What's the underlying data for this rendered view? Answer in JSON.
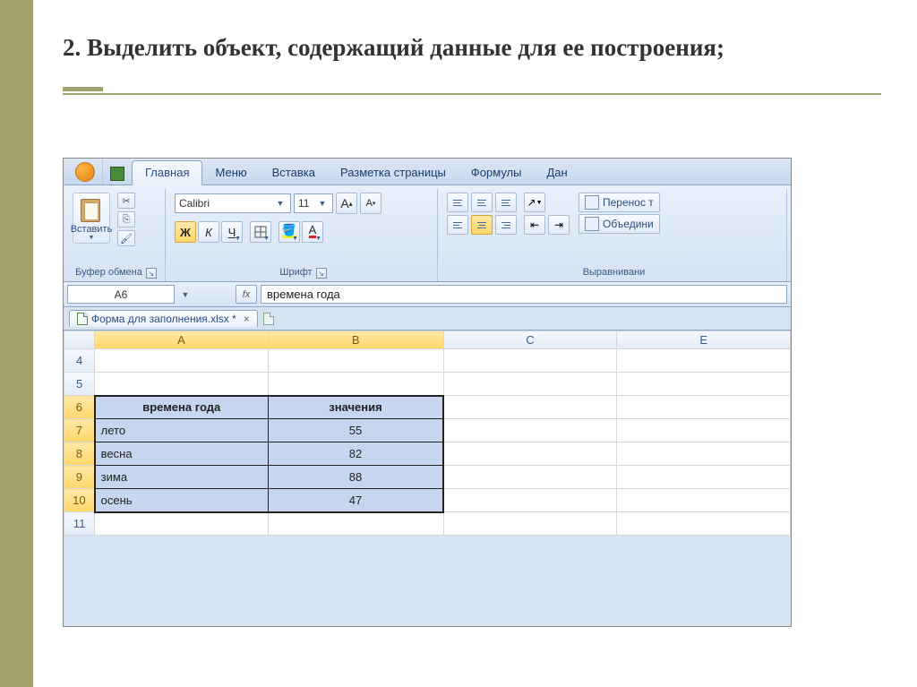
{
  "slide": {
    "title": "2. Выделить объект, содержащий данные для ее построения;"
  },
  "tabs": {
    "home": "Главная",
    "menu": "Меню",
    "insert": "Вставка",
    "layout": "Разметка страницы",
    "formulas": "Формулы",
    "data": "Дан"
  },
  "ribbon": {
    "clipboard_label": "Буфер обмена",
    "paste": "Вставить",
    "font_label": "Шрифт",
    "font_name": "Calibri",
    "font_size": "11",
    "align_label": "Выравнивани",
    "wrap": "Перенос т",
    "merge": "Объедини"
  },
  "formula": {
    "cell_ref": "А6",
    "value": "времена года"
  },
  "workbook": {
    "tab": "Форма для заполнения.xlsx *"
  },
  "grid": {
    "cols": [
      "A",
      "B",
      "C",
      "E"
    ],
    "rows": [
      "4",
      "5",
      "6",
      "7",
      "8",
      "9",
      "10",
      "11"
    ],
    "header_a": "времена года",
    "header_b": "значения",
    "data": [
      {
        "a": "лето",
        "b": "55"
      },
      {
        "a": "весна",
        "b": "82"
      },
      {
        "a": "зима",
        "b": "88"
      },
      {
        "a": "осень",
        "b": "47"
      }
    ]
  },
  "chart_data": {
    "type": "table",
    "title": "времена года / значения",
    "categories": [
      "лето",
      "весна",
      "зима",
      "осень"
    ],
    "values": [
      55,
      82,
      88,
      47
    ]
  }
}
